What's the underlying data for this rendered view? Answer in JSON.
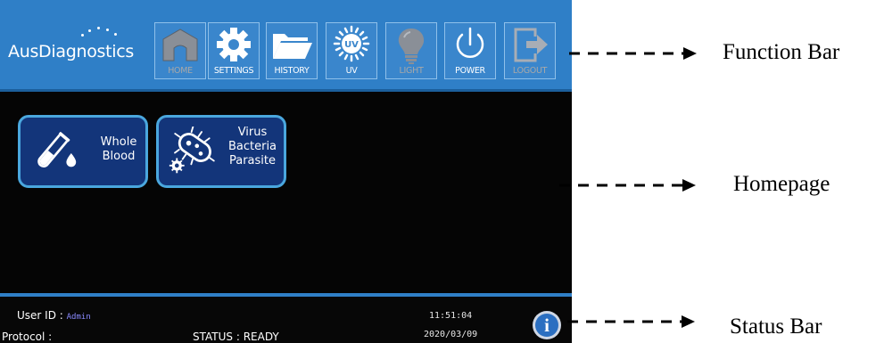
{
  "function_bar": {
    "logo": "AusDiagnostics",
    "buttons": [
      {
        "label": "HOME",
        "icon": "home-icon",
        "enabled": false
      },
      {
        "label": "SETTINGS",
        "icon": "gear-icon",
        "enabled": true
      },
      {
        "label": "HISTORY",
        "icon": "folder-icon",
        "enabled": true
      },
      {
        "label": "UV",
        "icon": "uv-icon",
        "enabled": true
      },
      {
        "label": "LIGHT",
        "icon": "lightbulb-icon",
        "enabled": false
      },
      {
        "label": "POWER",
        "icon": "power-icon",
        "enabled": true
      },
      {
        "label": "LOGOUT",
        "icon": "logout-icon",
        "enabled": false
      }
    ]
  },
  "homepage": {
    "tiles": [
      {
        "label_lines": [
          "Whole",
          "Blood"
        ],
        "icon": "test-tube-icon"
      },
      {
        "label_lines": [
          "Virus",
          "Bacteria",
          "Parasite"
        ],
        "icon": "bacteria-icon"
      }
    ]
  },
  "status_bar": {
    "user_id_label": "User ID :",
    "user_id_value": "Admin",
    "protocol_label": "Protocol :",
    "protocol_value": "",
    "status_text": "STATUS : READY",
    "time": "11:51:04",
    "date": "2020/03/09",
    "info_icon": "i"
  },
  "annotations": {
    "function_bar": "Function Bar",
    "homepage": "Homepage",
    "status_bar": "Status Bar"
  },
  "colors": {
    "bar_blue": "#2f7fc7",
    "tile_blue": "#13357a",
    "tile_border": "#4aa7de",
    "screen_bg": "#050505"
  }
}
